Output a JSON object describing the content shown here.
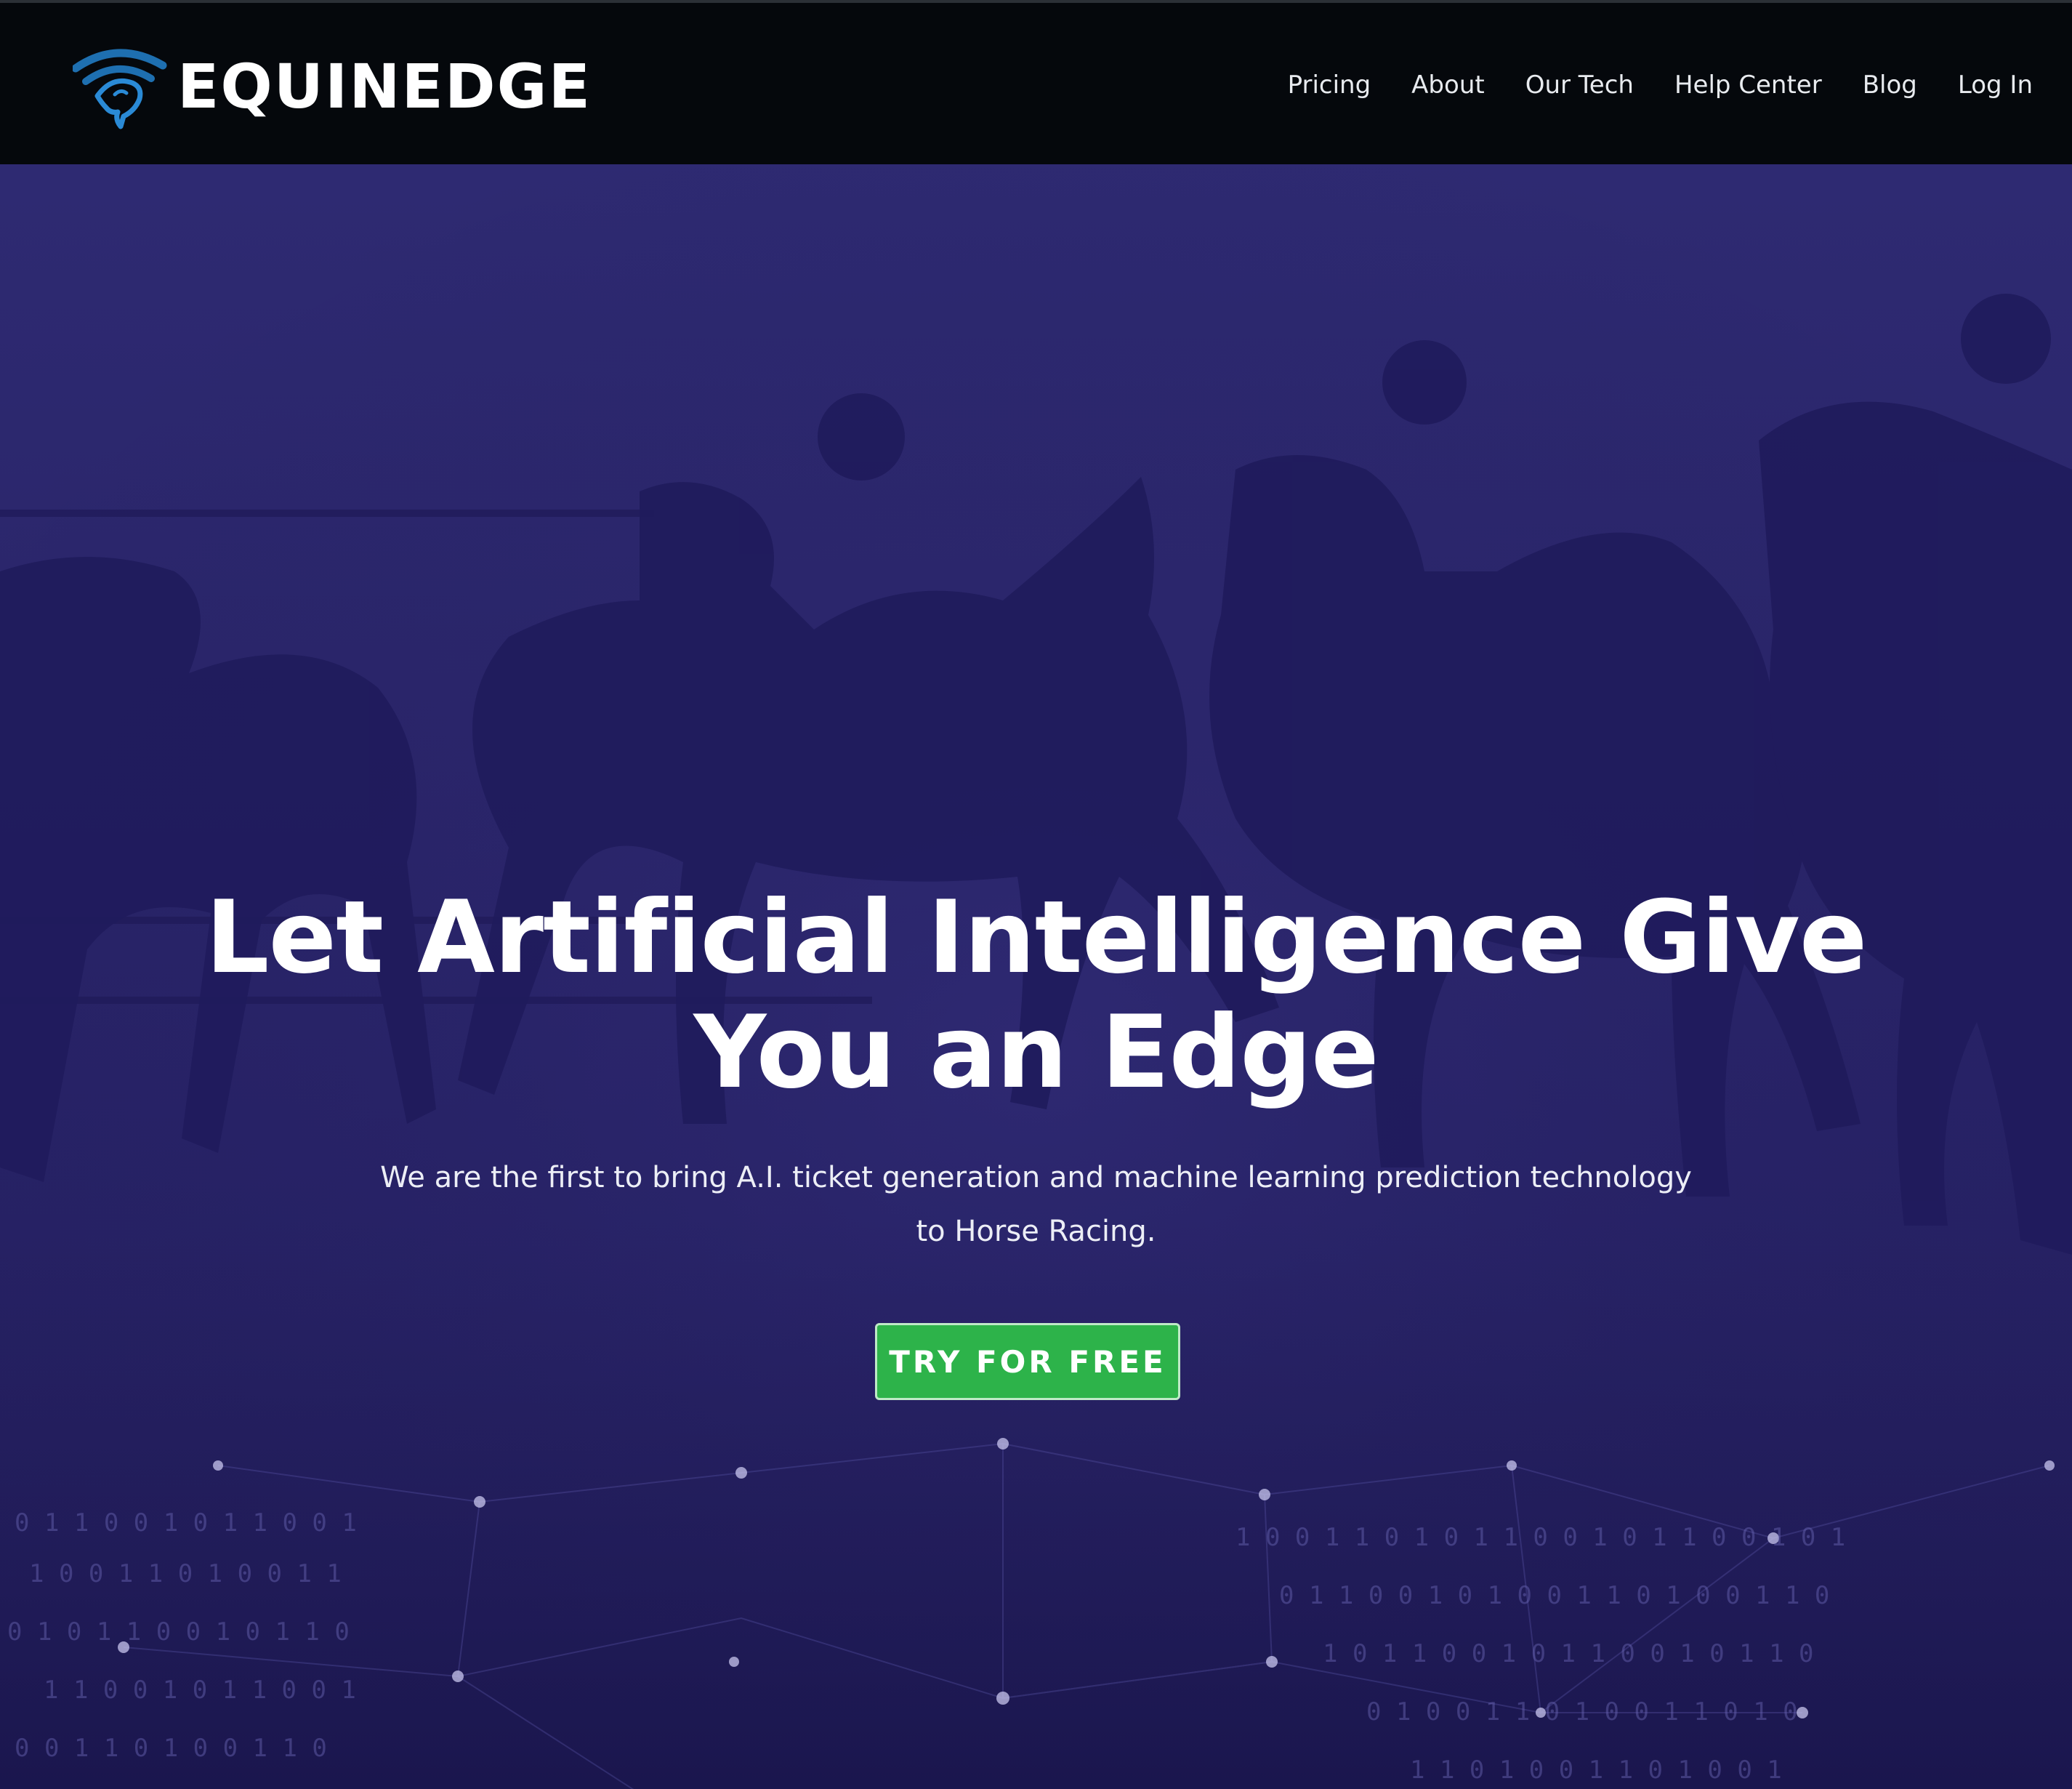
{
  "brand": {
    "name": "EQUINEDGE",
    "logo_icon": "horse-head-signal-icon",
    "accent_color": "#1e6fb0"
  },
  "nav": {
    "items": [
      {
        "label": "Pricing"
      },
      {
        "label": "About"
      },
      {
        "label": "Our Tech"
      },
      {
        "label": "Help Center"
      },
      {
        "label": "Blog"
      },
      {
        "label": "Log In"
      }
    ]
  },
  "hero": {
    "headline_line1": "Let Artificial Intelligence Give",
    "headline_line2": "You an Edge",
    "subtext": "We are the first to bring A.I. ticket generation and machine learning prediction technology to Horse Racing.",
    "cta_label": "TRY FOR FREE",
    "cta_color": "#2db34a",
    "background_color": "#2a2470"
  }
}
